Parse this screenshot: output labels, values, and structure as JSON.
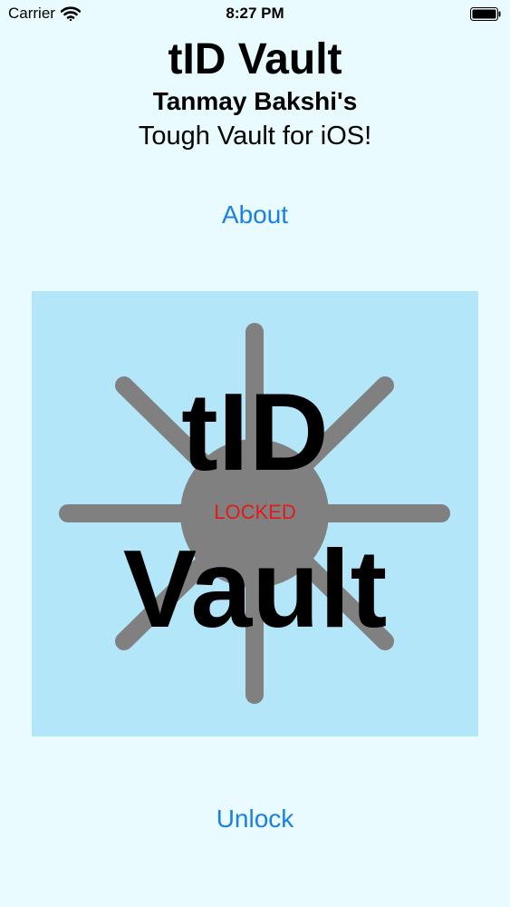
{
  "status_bar": {
    "carrier": "Carrier",
    "time": "8:27 PM",
    "wifi_icon": "wifi-icon",
    "battery_icon": "battery-icon"
  },
  "header": {
    "title": "tID Vault",
    "subtitle": "Tanmay Bakshi's",
    "tagline": "Tough Vault for iOS!"
  },
  "about_button": "About",
  "vault": {
    "word_top": "tID",
    "word_bottom": "Vault",
    "status": "LOCKED",
    "status_color": "#e11b1b",
    "panel_color": "#b3e6f8",
    "sun_color": "#808080"
  },
  "unlock_button": "Unlock",
  "accent_color": "#1b7fe3"
}
